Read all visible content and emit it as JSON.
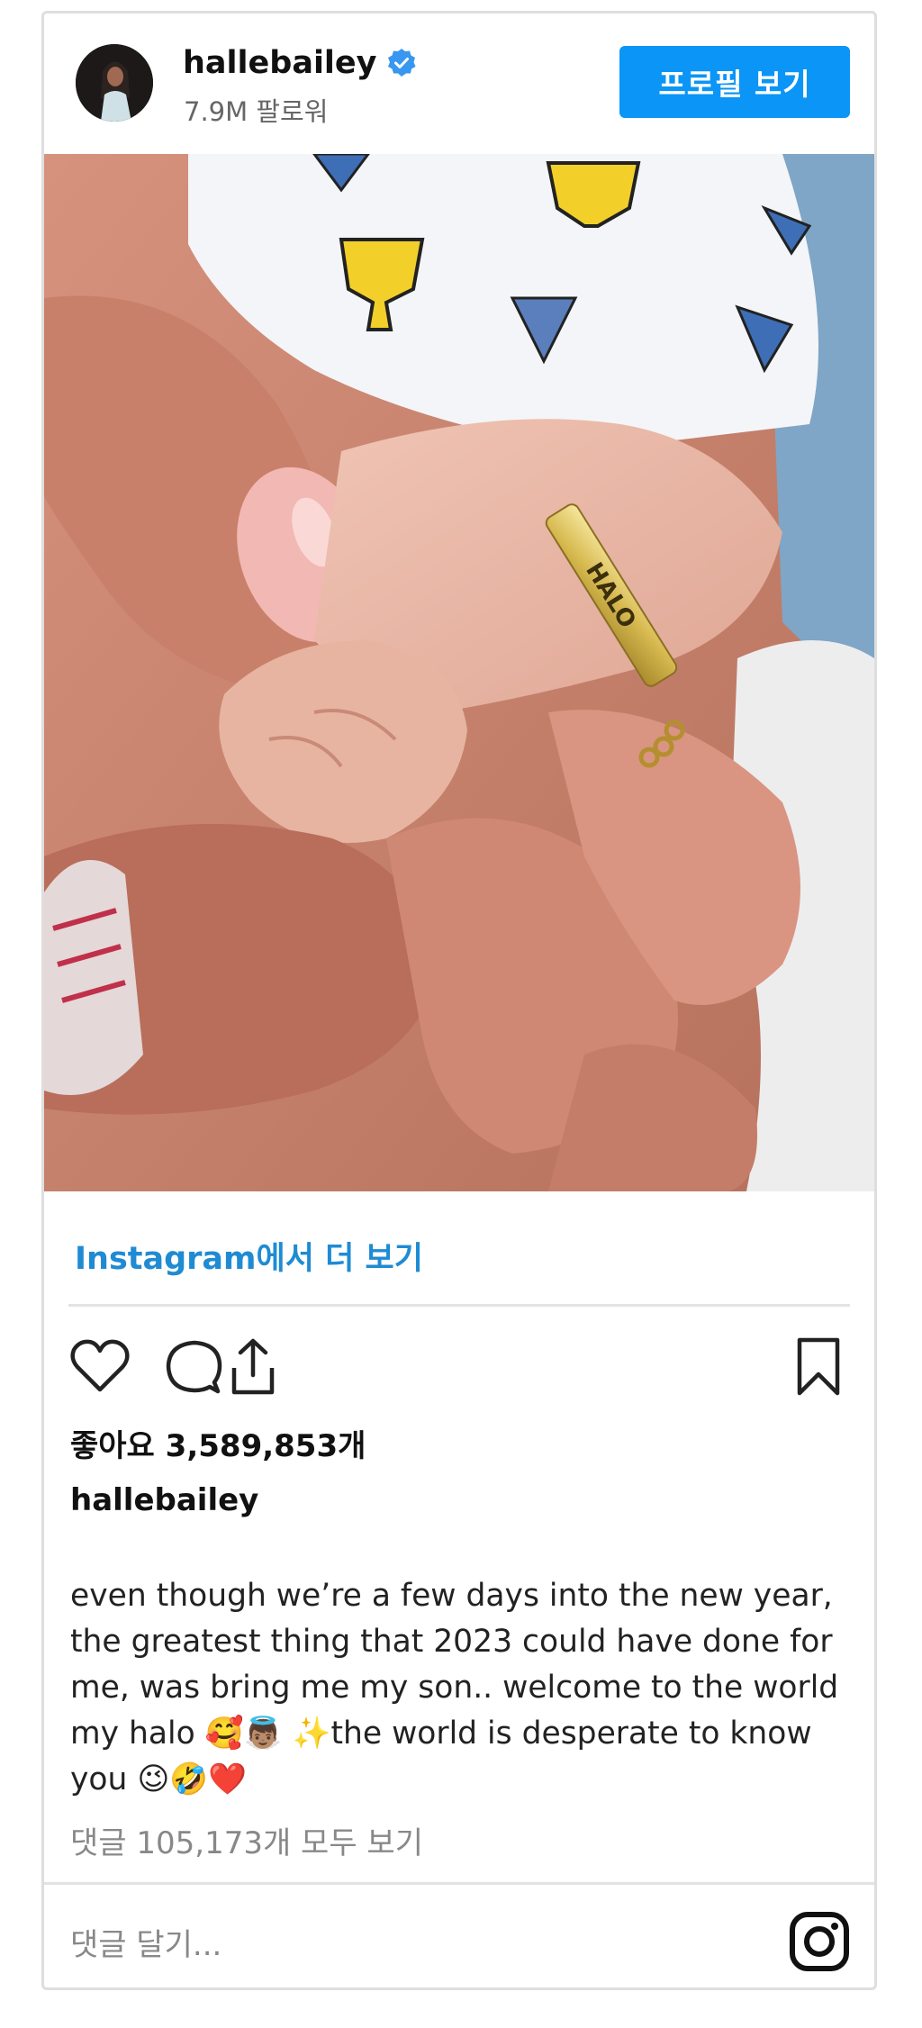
{
  "header": {
    "username": "hallebailey",
    "followers": "7.9M 팔로워",
    "profile_button": "프로필 보기"
  },
  "post": {
    "view_more": "Instagram에서 더 보기",
    "likes": "좋아요 3,589,853개",
    "caption_user": "hallebailey",
    "caption_lines": [
      "even though we’re a few days into the new year,",
      "the greatest thing that 2023 could have done for",
      "me, was bring me my son.. welcome to the world",
      "my halo 🥰👼🏽 ✨the world is desperate to know",
      "you 😉🤣❤️"
    ],
    "bracelet_text": "HALO",
    "comments_link": "댓글 105,173개 모두 보기",
    "comment_placeholder": "댓글 달기..."
  },
  "icons": {
    "like": "heart-icon",
    "comment": "comment-bubble-icon",
    "share": "share-icon",
    "save": "bookmark-icon",
    "verified": "verified-badge-icon",
    "instagram": "instagram-logo-icon"
  },
  "colors": {
    "accent": "#0b95f6",
    "link": "#1f8bd3",
    "muted_text": "#888888"
  }
}
